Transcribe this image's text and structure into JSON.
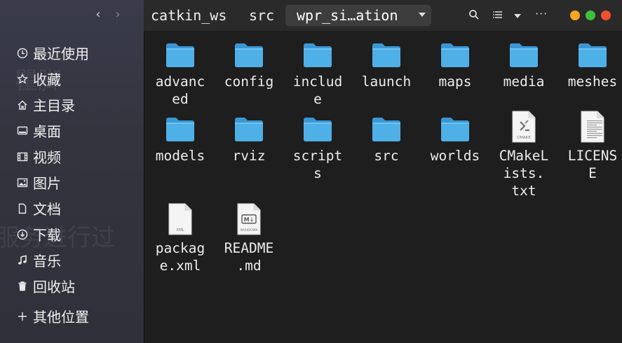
{
  "sidebar": {
    "nav": {
      "back_icon": "chevron-left-icon",
      "forward_icon": "chevron-right-icon"
    },
    "background_text": [
      "瞿脚",
      "服务进行过"
    ],
    "items": [
      {
        "label": "最近使用",
        "icon": "clock-icon"
      },
      {
        "label": "收藏",
        "icon": "star-icon"
      },
      {
        "label": "主目录",
        "icon": "home-icon"
      },
      {
        "label": "桌面",
        "icon": "desktop-icon"
      },
      {
        "label": "视频",
        "icon": "film-icon"
      },
      {
        "label": "图片",
        "icon": "image-icon"
      },
      {
        "label": "文档",
        "icon": "document-icon"
      },
      {
        "label": "下载",
        "icon": "download-icon"
      },
      {
        "label": "音乐",
        "icon": "music-icon"
      },
      {
        "label": "回收站",
        "icon": "trash-icon"
      }
    ],
    "other_locations": {
      "label": "其他位置",
      "icon": "plus-icon"
    }
  },
  "header": {
    "breadcrumbs": [
      "catkin_ws",
      "src"
    ],
    "current": "wpr_si…ation",
    "search_icon": "search-icon",
    "view_icon": "list-view-icon",
    "menu_icon": "more-icon",
    "window_buttons": {
      "minimize": "#f5a623",
      "maximize": "#3cc13b",
      "close": "#f1502f"
    }
  },
  "files": [
    {
      "name": "advanced",
      "display": "advanc\ned",
      "type": "folder"
    },
    {
      "name": "config",
      "display": "config",
      "type": "folder"
    },
    {
      "name": "include",
      "display": "includ\ne",
      "type": "folder"
    },
    {
      "name": "launch",
      "display": "launch",
      "type": "folder"
    },
    {
      "name": "maps",
      "display": "maps",
      "type": "folder"
    },
    {
      "name": "media",
      "display": "media",
      "type": "folder"
    },
    {
      "name": "meshes",
      "display": "meshes",
      "type": "folder"
    },
    {
      "name": "models",
      "display": "models",
      "type": "folder"
    },
    {
      "name": "rviz",
      "display": "rviz",
      "type": "folder"
    },
    {
      "name": "scripts",
      "display": "script\ns",
      "type": "folder"
    },
    {
      "name": "src",
      "display": "src",
      "type": "folder"
    },
    {
      "name": "worlds",
      "display": "worlds",
      "type": "folder"
    },
    {
      "name": "CMakeLists.txt",
      "display": "CMakeL\nists.\ntxt",
      "type": "cmake",
      "badge": "CMAKE"
    },
    {
      "name": "LICENSE",
      "display": "LICENS\nE",
      "type": "text"
    },
    {
      "name": "package.xml",
      "display": "packag\ne.xml",
      "type": "xml",
      "badge": "XML",
      "glyph": "</>"
    },
    {
      "name": "README.md",
      "display": "README\n.md",
      "type": "markdown",
      "badge": "MARKDOWN",
      "glyph": "M↓"
    }
  ],
  "colors": {
    "folder_front": "#4fb0e8",
    "folder_back": "#3a97d4",
    "accent": "#4fb0e8"
  }
}
